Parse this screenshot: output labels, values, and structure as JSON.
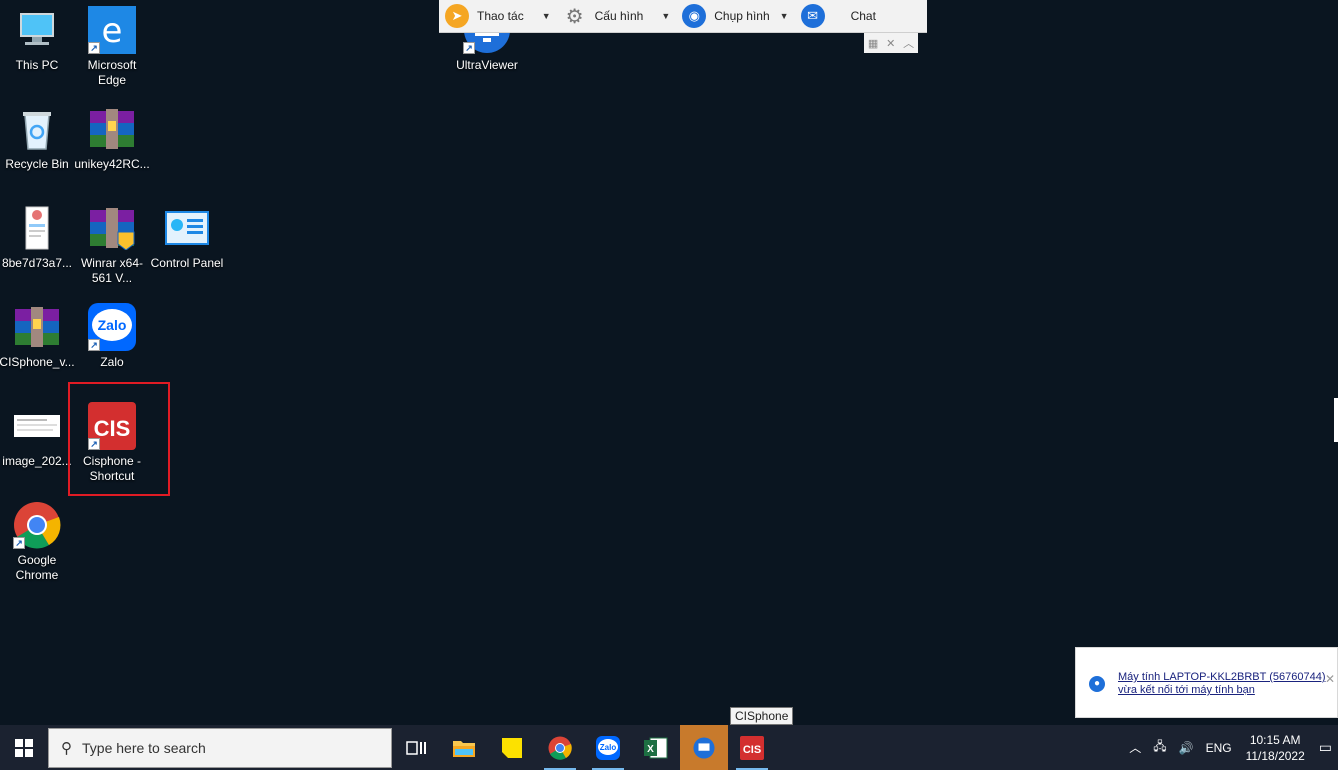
{
  "desktop": {
    "icons": {
      "this_pc": "This PC",
      "edge": "Microsoft Edge",
      "recycle_bin": "Recycle Bin",
      "unikey": "unikey42RC...",
      "image_file": "8be7d73a7...",
      "winrar": "Winrar x64-561 V...",
      "control_panel": "Control Panel",
      "cisphone_v": "CISphone_v...",
      "zalo": "Zalo",
      "image_202": "image_202...",
      "cisphone_shortcut": "Cisphone - Shortcut",
      "chrome": "Google Chrome",
      "ultraviewer": "UltraViewer"
    }
  },
  "toolbar": {
    "thao_tac": "Thao tác",
    "cau_hinh": "Cấu hình",
    "chup_hinh": "Chụp hình",
    "chat": "Chat"
  },
  "notification": {
    "text": "Máy tính LAPTOP-KKL2BRBT (56760744) vừa kết nối tới máy tính bạn"
  },
  "tooltip": "CISphone",
  "taskbar": {
    "search_placeholder": "Type here to search",
    "language": "ENG",
    "time": "10:15 AM",
    "date": "11/18/2022"
  },
  "colors": {
    "desktop_bg": "#0a1520",
    "highlight": "#e01b24",
    "taskbar_bg": "#1b2230",
    "active_app": "#c87a2c"
  }
}
